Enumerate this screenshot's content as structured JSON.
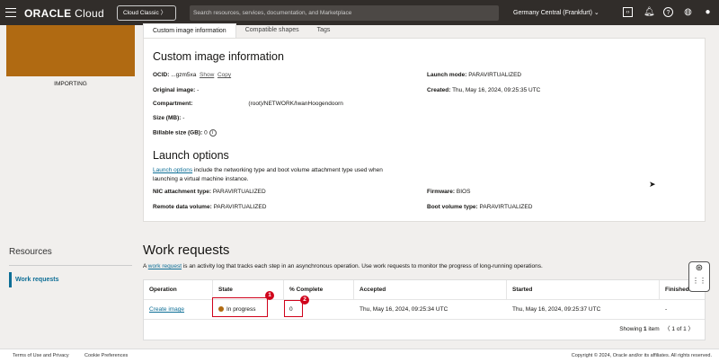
{
  "header": {
    "brand": "ORACLE",
    "brand_suffix": "Cloud",
    "classic_label": "Cloud Classic",
    "classic_chevron": "〉",
    "search_placeholder": "Search resources, services, documentation, and Marketplace",
    "region": "Germany Central (Frankfurt)",
    "icons": [
      "menu-icon",
      "code-editor-icon",
      "bell-icon",
      "help-icon",
      "globe-icon",
      "user-icon"
    ],
    "bg": "#312d2a"
  },
  "image_status": "IMPORTING",
  "status_color": "#b06a12",
  "tabs": [
    {
      "label": "Custom image information"
    },
    {
      "label": "Compatible shapes"
    },
    {
      "label": "Tags"
    }
  ],
  "info": {
    "title": "Custom image information",
    "ocid_label": "OCID:",
    "ocid_value": "...gzm5xa",
    "show": "Show",
    "copy": "Copy",
    "original_label": "Original image:",
    "original_value": "-",
    "compartment_label": "Compartment:",
    "compartment_value": "(root)/NETWORK/IwanHoogendoorn",
    "size_label": "Size (MB):",
    "size_value": "-",
    "billable_label": "Billable size (GB):",
    "billable_value": "0",
    "launch_mode_label": "Launch mode:",
    "launch_mode_value": "PARAVIRTUALIZED",
    "created_label": "Created:",
    "created_value": "Thu, May 16, 2024, 09:25:35 UTC"
  },
  "launch": {
    "title": "Launch options",
    "link": "Launch options",
    "desc1": "include the networking type and boot volume attachment type used when",
    "desc2": "launching a virtual machine instance.",
    "nic_label": "NIC attachment type:",
    "nic_value": "PARAVIRTUALIZED",
    "remote_label": "Remote data volume:",
    "remote_value": "PARAVIRTUALIZED",
    "firmware_label": "Firmware:",
    "firmware_value": "BIOS",
    "boot_label": "Boot volume type:",
    "boot_value": "PARAVIRTUALIZED"
  },
  "resources": {
    "title": "Resources",
    "items": [
      {
        "label": "Work requests"
      }
    ]
  },
  "work_requests": {
    "title": "Work requests",
    "desc_prefix": "A",
    "desc_link": "work request",
    "desc_rest": "is an activity log that tracks each step in an asynchronous operation. Use work requests to monitor the progress of long-running operations.",
    "columns": [
      "Operation",
      "State",
      "% Complete",
      "Accepted",
      "Started",
      "Finished"
    ],
    "rows": [
      {
        "operation": "Create image",
        "state": "In progress",
        "complete": "0",
        "accepted": "Thu, May 16, 2024, 09:25:34 UTC",
        "started": "Thu, May 16, 2024, 09:25:37 UTC",
        "finished": "-"
      }
    ],
    "showing_prefix": "Showing",
    "showing_count": "1",
    "showing_suffix": "item",
    "page": "1 of 1"
  },
  "annotations": [
    "1",
    "2"
  ],
  "footer": {
    "terms": "Terms of Use and Privacy",
    "cookies": "Cookie Preferences",
    "copyright": "Copyright © 2024, Oracle and/or its affiliates. All rights reserved."
  }
}
